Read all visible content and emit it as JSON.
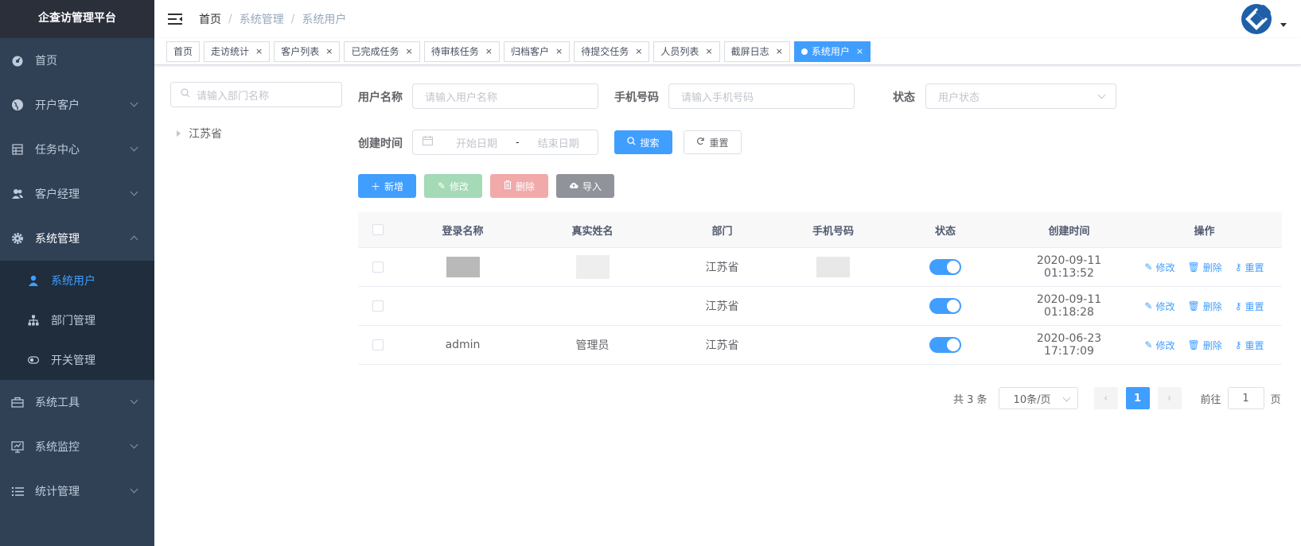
{
  "app": {
    "title": "企查访管理平台"
  },
  "sidebar": {
    "items": [
      {
        "label": "首页",
        "icon": "dashboard-icon"
      },
      {
        "label": "开户客户",
        "icon": "globe-icon"
      },
      {
        "label": "任务中心",
        "icon": "table-icon"
      },
      {
        "label": "客户经理",
        "icon": "peoples-icon"
      },
      {
        "label": "系统管理",
        "icon": "gear-icon"
      },
      {
        "label": "系统工具",
        "icon": "toolbox-icon"
      },
      {
        "label": "系统监控",
        "icon": "monitor-icon"
      },
      {
        "label": "统计管理",
        "icon": "list-icon"
      }
    ],
    "submenu": [
      {
        "label": "系统用户",
        "icon": "user-icon"
      },
      {
        "label": "部门管理",
        "icon": "tree-icon"
      },
      {
        "label": "开关管理",
        "icon": "toggle-icon"
      }
    ]
  },
  "breadcrumb": [
    "首页",
    "系统管理",
    "系统用户"
  ],
  "tags": [
    {
      "label": "首页",
      "closable": false
    },
    {
      "label": "走访统计",
      "closable": true
    },
    {
      "label": "客户列表",
      "closable": true
    },
    {
      "label": "已完成任务",
      "closable": true
    },
    {
      "label": "待审核任务",
      "closable": true
    },
    {
      "label": "归档客户",
      "closable": true
    },
    {
      "label": "待提交任务",
      "closable": true
    },
    {
      "label": "人员列表",
      "closable": true
    },
    {
      "label": "截屏日志",
      "closable": true
    },
    {
      "label": "系统用户",
      "closable": true
    }
  ],
  "tree": {
    "search_placeholder": "请输入部门名称",
    "root": "江苏省"
  },
  "form": {
    "username_label": "用户名称",
    "username_placeholder": "请输入用户名称",
    "phone_label": "手机号码",
    "phone_placeholder": "请输入手机号码",
    "status_label": "状态",
    "status_placeholder": "用户状态",
    "created_label": "创建时间",
    "start_placeholder": "开始日期",
    "range_sep": "-",
    "end_placeholder": "结束日期",
    "search_btn": "搜索",
    "reset_btn": "重置"
  },
  "toolbar": {
    "add": "新增",
    "edit": "修改",
    "delete": "删除",
    "import": "导入"
  },
  "table": {
    "headers": [
      "登录名称",
      "真实姓名",
      "部门",
      "手机号码",
      "状态",
      "创建时间",
      "操作"
    ],
    "rows": [
      {
        "login": "",
        "real": "",
        "dept": "江苏省",
        "phone": "",
        "status": true,
        "created": "2020-09-11 01:13:52"
      },
      {
        "login": "",
        "real": "",
        "dept": "江苏省",
        "phone": "",
        "status": true,
        "created": "2020-09-11 01:18:28"
      },
      {
        "login": "admin",
        "real": "管理员",
        "dept": "江苏省",
        "phone": "",
        "status": true,
        "created": "2020-06-23 17:17:09"
      }
    ],
    "ops": {
      "edit": "修改",
      "delete": "删除",
      "reset": "重置"
    }
  },
  "pagination": {
    "total": "共 3 条",
    "page_size": "10条/页",
    "current": "1",
    "goto_label": "前往",
    "goto_value": "1",
    "page_suffix": "页"
  },
  "colors": {
    "sidebar_bg": "#304156",
    "submenu_bg": "#1f2d3d",
    "primary": "#409eff"
  }
}
